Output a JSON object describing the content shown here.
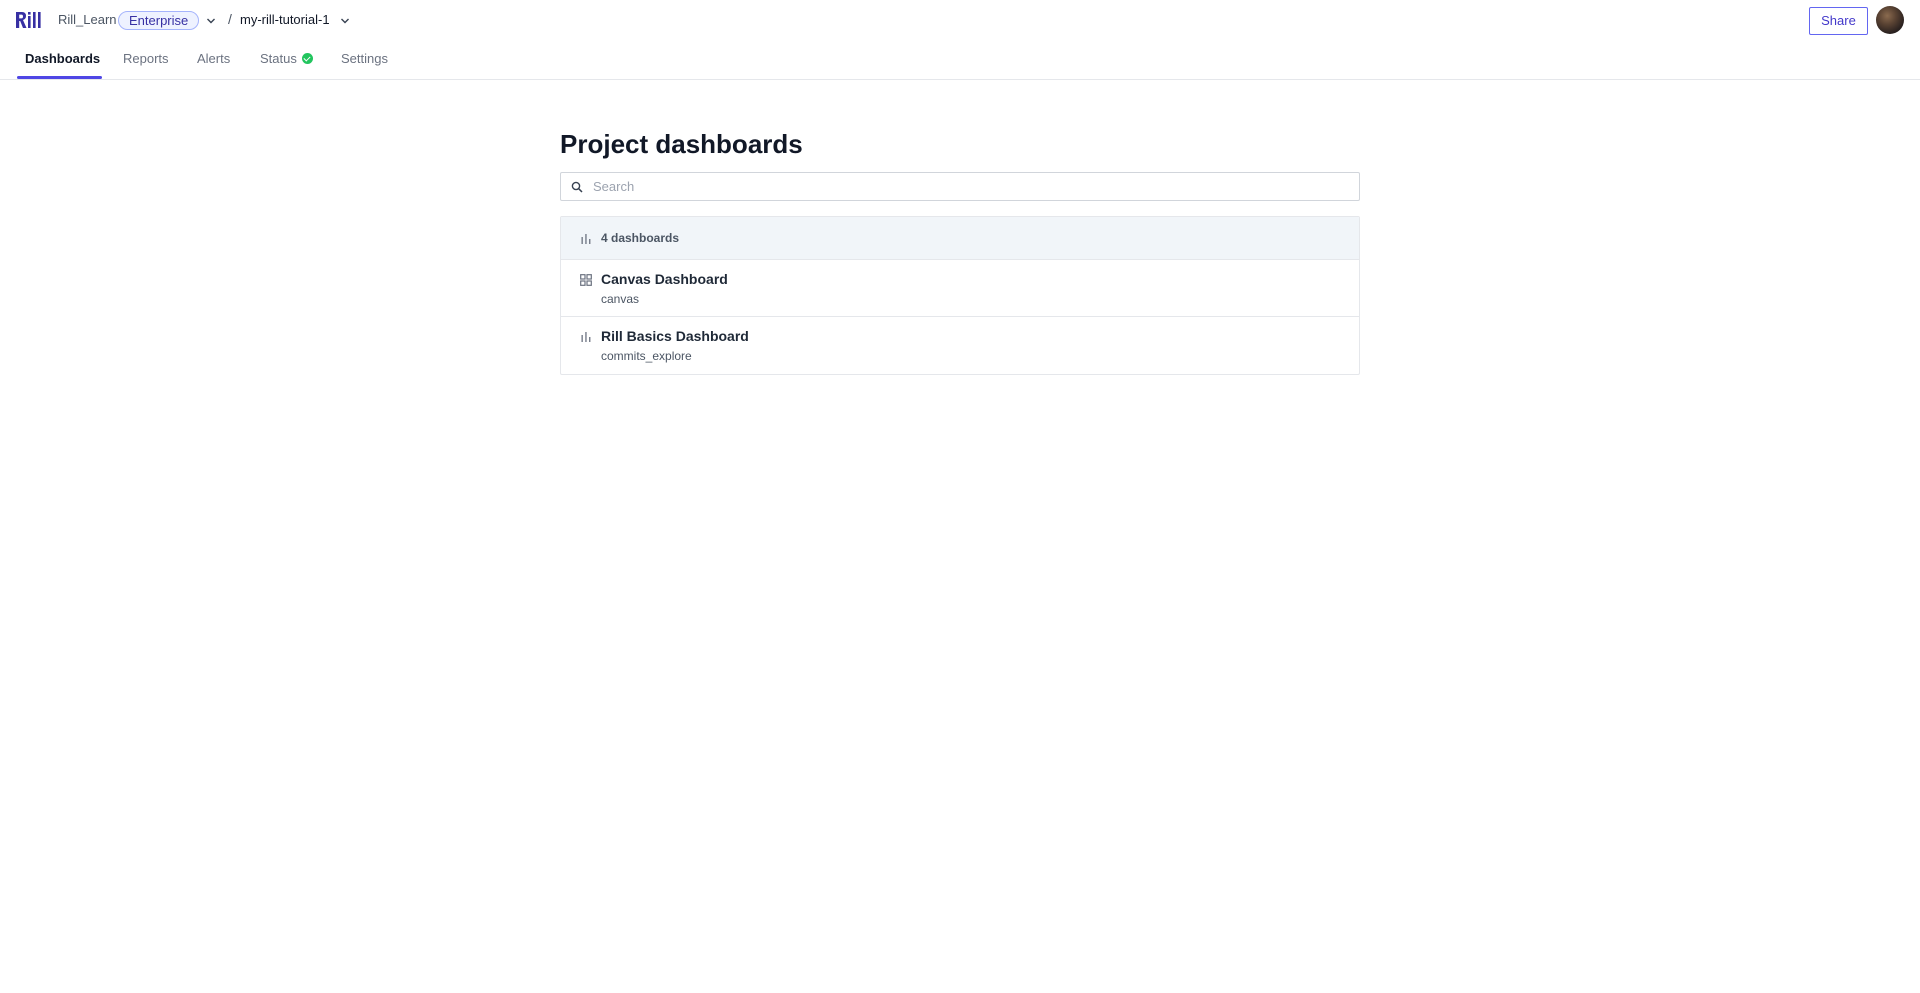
{
  "header": {
    "org_name": "Rill_Learn",
    "plan_badge": "Enterprise",
    "separator": "/",
    "project_name": "my-rill-tutorial-1",
    "share_label": "Share"
  },
  "tabs": [
    {
      "label": "Dashboards",
      "active": true
    },
    {
      "label": "Reports",
      "active": false
    },
    {
      "label": "Alerts",
      "active": false
    },
    {
      "label": "Status",
      "active": false
    },
    {
      "label": "Settings",
      "active": false
    }
  ],
  "main": {
    "title": "Project dashboards",
    "search_placeholder": "Search",
    "list_header": "4 dashboards",
    "dashboards": [
      {
        "name": "Canvas Dashboard",
        "id": "canvas",
        "icon": "canvas-icon"
      },
      {
        "name": "Rill Basics Dashboard",
        "id": "commits_explore",
        "icon": "bar-chart-icon"
      }
    ]
  },
  "colors": {
    "accent": "#4f46e5",
    "status_ok": "#22c55e",
    "header_bg": "#f1f5f9"
  }
}
